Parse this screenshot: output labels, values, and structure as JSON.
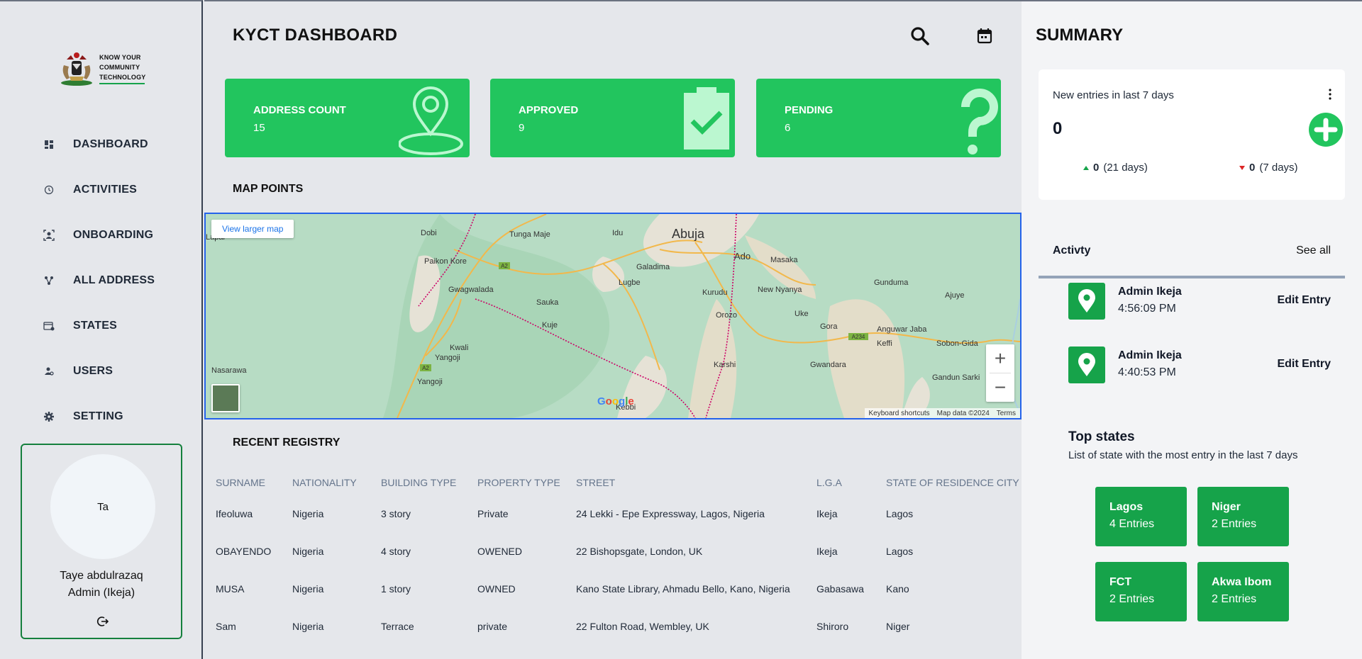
{
  "logo": {
    "lines": [
      "KNOW YOUR",
      "COMMUNITY",
      "TECHNOLOGY"
    ]
  },
  "nav": [
    {
      "label": "DASHBOARD",
      "icon": "dashboard-icon"
    },
    {
      "label": "ACTIVITIES",
      "icon": "clock-icon"
    },
    {
      "label": "ONBOARDING",
      "icon": "onboarding-icon"
    },
    {
      "label": "ALL ADDRESS",
      "icon": "address-icon"
    },
    {
      "label": "STATES",
      "icon": "states-icon"
    },
    {
      "label": "USERS",
      "icon": "users-icon"
    },
    {
      "label": "SETTING",
      "icon": "gear-icon"
    }
  ],
  "profile": {
    "initials": "Ta",
    "name": "Taye abdulrazaq",
    "role": "Admin (Ikeja)"
  },
  "header": {
    "title": "KYCT DASHBOARD"
  },
  "stats": [
    {
      "title": "ADDRESS COUNT",
      "value": "15",
      "icon": "map-pin-icon"
    },
    {
      "title": "APPROVED",
      "value": "9",
      "icon": "clipboard-check-icon"
    },
    {
      "title": "PENDING",
      "value": "6",
      "icon": "question-icon"
    }
  ],
  "map_section": {
    "title": "MAP POINTS",
    "larger_map": "View larger map",
    "labels": {
      "abuja": "Abuja",
      "dobi": "Dobi",
      "tunga_maje": "Tunga Maje",
      "idu": "Idu",
      "lapai": "Lapai",
      "paikon_kore": "Paikon Kore",
      "galadima": "Galadima",
      "ado": "Ado",
      "masaka": "Masaka",
      "gwagwalada": "Gwagwalada",
      "lugbe": "Lugbe",
      "new_nyanya": "New Nyanya",
      "gunduma": "Gunduma",
      "ajuye": "Ajuye",
      "kurudu": "Kurudu",
      "sauka": "Sauka",
      "orozo": "Orozo",
      "uke": "Uke",
      "kuje": "Kuje",
      "gora": "Gora",
      "anguwar_jaba": "Anguwar Jaba",
      "keffi": "Keffi",
      "sobon_gida": "Sobon-Gida",
      "kwali": "Kwali",
      "yangoji": "Yangoji",
      "nasarawa": "Nasarawa",
      "karshi": "Karshi",
      "gwandara": "Gwandara",
      "gandun_sarki": "Gandun Sarki",
      "kebbi": "Kebbi",
      "a2": "A2",
      "a234": "A234"
    },
    "google": "Google",
    "footer": [
      "Keyboard shortcuts",
      "Map data ©2024",
      "Terms"
    ]
  },
  "registry": {
    "title": "RECENT REGISTRY",
    "columns": [
      "SURNAME",
      "NATIONALITY",
      "BUILDING TYPE",
      "PROPERTY TYPE",
      "STREET",
      "L.G.A",
      "STATE OF RESIDENCE CITY"
    ],
    "rows": [
      [
        "Ifeoluwa",
        "Nigeria",
        "3 story",
        "Private",
        "24 Lekki - Epe Expressway, Lagos, Nigeria",
        "Ikeja",
        "Lagos"
      ],
      [
        "OBAYENDO",
        "Nigeria",
        "4 story",
        "OWENED",
        "22 Bishopsgate, London, UK",
        "Ikeja",
        "Lagos"
      ],
      [
        "MUSA",
        "Nigeria",
        "1 story",
        "OWNED",
        "Kano State Library, Ahmadu Bello, Kano, Nigeria",
        "Gabasawa",
        "Kano"
      ],
      [
        "Sam",
        "Nigeria",
        "Terrace",
        "private",
        "22 Fulton Road, Wembley, UK",
        "Shiroro",
        "Niger"
      ]
    ]
  },
  "summary": {
    "title": "SUMMARY",
    "entries_label": "New entries in last 7 days",
    "count": "0",
    "up": {
      "value": "0",
      "period": "(21 days)"
    },
    "down": {
      "value": "0",
      "period": "(7 days)"
    }
  },
  "activity": {
    "title": "Activty",
    "see_all": "See all",
    "items": [
      {
        "name": "Admin Ikeja",
        "time": "4:56:09 PM",
        "action": "Edit Entry"
      },
      {
        "name": "Admin Ikeja",
        "time": "4:40:53 PM",
        "action": "Edit Entry"
      }
    ]
  },
  "top_states": {
    "title": "Top states",
    "subtitle": "List of state with the most entry in the last 7 days",
    "items": [
      {
        "name": "Lagos",
        "entries": "4 Entries"
      },
      {
        "name": "Niger",
        "entries": "2 Entries"
      },
      {
        "name": "FCT",
        "entries": "2 Entries"
      },
      {
        "name": "Akwa Ibom",
        "entries": "2 Entries"
      }
    ]
  },
  "colors": {
    "accent": "#22c55e",
    "accent_dark": "#16a34a",
    "border": "#15803d",
    "map_border": "#2563eb"
  }
}
